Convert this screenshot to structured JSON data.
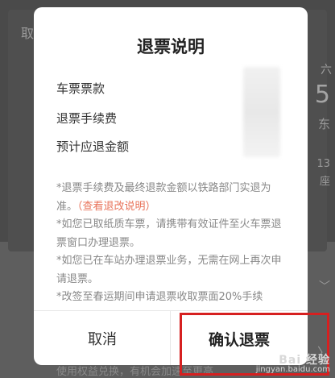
{
  "background": {
    "left_label": "取",
    "right_labels": [
      "六",
      "5",
      "东",
      "13",
      "座"
    ],
    "bottom_text": "使用权益兑换，有机会加速至更高"
  },
  "modal": {
    "title": "退票说明",
    "rows": [
      {
        "label": "车票票款"
      },
      {
        "label": "退票手续费"
      },
      {
        "label": "预计应退金额"
      }
    ],
    "notes": {
      "n1_text": "*退票手续费及最终退款金额以铁路部门实退为准。",
      "n1_link": "（查看退改说明）",
      "n2": "*如您已取纸质车票，请携带有效证件至火车票退票窗口办理退票。",
      "n3": "*如您已在车站办理退票业务，无需在网上再次申请退票。",
      "n4": "*改签至春运期间申请退票收取票面20%手续"
    },
    "cancel_label": "取消",
    "confirm_label": "确认退票"
  },
  "watermark": {
    "logo": "Bai 经验",
    "url": "jingyan.baidu.com"
  },
  "colors": {
    "link": "#e8735a",
    "highlight": "#d62020"
  }
}
